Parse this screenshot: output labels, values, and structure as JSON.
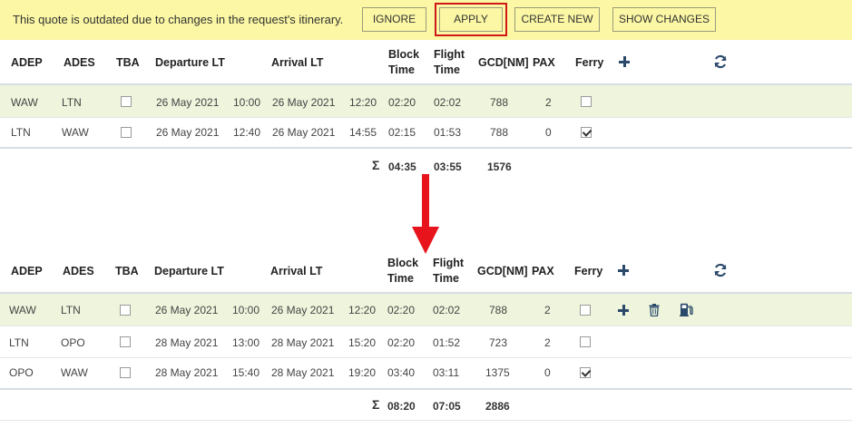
{
  "banner": {
    "message": "This quote is outdated due to changes in the request's itinerary.",
    "ignore_label": "IGNORE",
    "apply_label": "APPLY",
    "create_new_label": "CREATE NEW",
    "show_changes_label": "SHOW CHANGES"
  },
  "headers": {
    "adep": "ADEP",
    "ades": "ADES",
    "tba": "TBA",
    "departure": "Departure LT",
    "arrival": "Arrival LT",
    "block_1": "Block",
    "block_2": "Time",
    "flight_1": "Flight",
    "flight_2": "Time",
    "gcd": "GCD[NM]",
    "pax": "PAX",
    "ferry": "Ferry"
  },
  "before": {
    "rows": [
      {
        "adep": "WAW",
        "ades": "LTN",
        "tba": false,
        "dep_date": "26 May 2021",
        "dep_time": "10:00",
        "arr_date": "26 May 2021",
        "arr_time": "12:20",
        "block": "02:20",
        "flight": "02:02",
        "gcd": "788",
        "pax": "2",
        "ferry": false
      },
      {
        "adep": "LTN",
        "ades": "WAW",
        "tba": false,
        "dep_date": "26 May 2021",
        "dep_time": "12:40",
        "arr_date": "26 May 2021",
        "arr_time": "14:55",
        "block": "02:15",
        "flight": "01:53",
        "gcd": "788",
        "pax": "0",
        "ferry": true
      }
    ],
    "sum_symbol": "Σ",
    "total_block": "04:35",
    "total_flight": "03:55",
    "total_gcd": "1576"
  },
  "after": {
    "rows": [
      {
        "adep": "WAW",
        "ades": "LTN",
        "tba": false,
        "dep_date": "26 May 2021",
        "dep_time": "10:00",
        "arr_date": "26 May 2021",
        "arr_time": "12:20",
        "block": "02:20",
        "flight": "02:02",
        "gcd": "788",
        "pax": "2",
        "ferry": false
      },
      {
        "adep": "LTN",
        "ades": "OPO",
        "tba": false,
        "dep_date": "28 May 2021",
        "dep_time": "13:00",
        "arr_date": "28 May 2021",
        "arr_time": "15:20",
        "block": "02:20",
        "flight": "01:52",
        "gcd": "723",
        "pax": "2",
        "ferry": false
      },
      {
        "adep": "OPO",
        "ades": "WAW",
        "tba": false,
        "dep_date": "28 May 2021",
        "dep_time": "15:40",
        "arr_date": "28 May 2021",
        "arr_time": "19:20",
        "block": "03:40",
        "flight": "03:11",
        "gcd": "1375",
        "pax": "0",
        "ferry": true
      }
    ],
    "sum_symbol": "Σ",
    "total_block": "08:20",
    "total_flight": "07:05",
    "total_gcd": "2886"
  },
  "icons": {
    "add": "plus-icon",
    "refresh": "refresh-icon",
    "delete": "trash-icon",
    "fuel": "fuel-icon",
    "arrow": "arrow-down-icon"
  },
  "colors": {
    "banner_bg": "#fbf7a4",
    "highlight_row": "#eef5dc",
    "apply_outline": "#d01818",
    "arrow": "#e8141c",
    "icon": "#2b4a6b"
  }
}
